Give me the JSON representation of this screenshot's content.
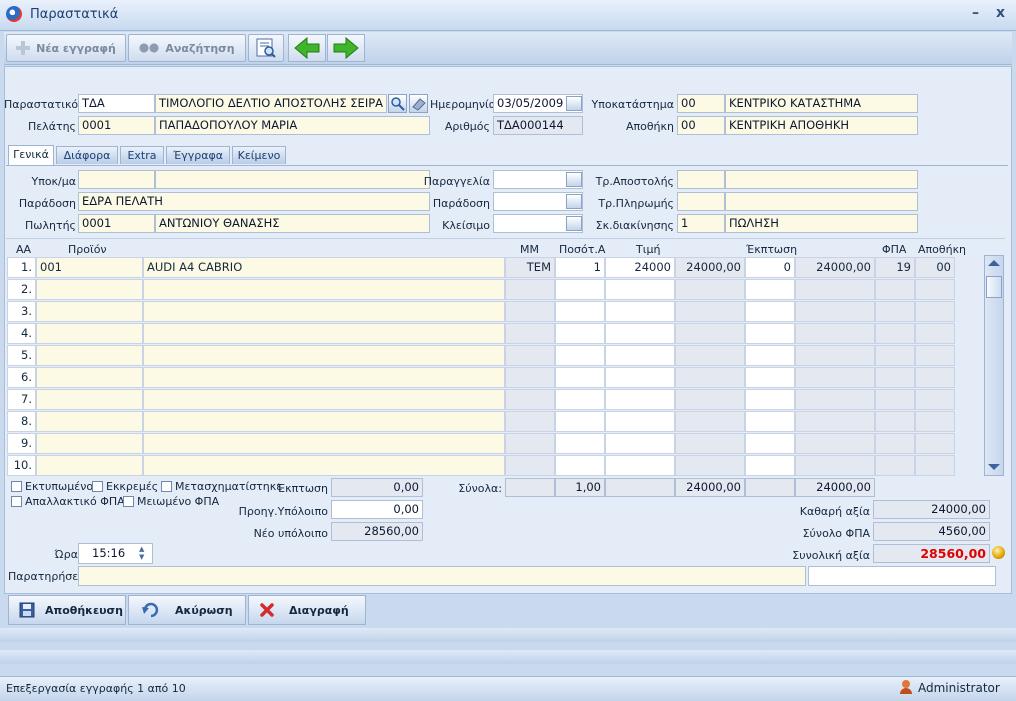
{
  "window": {
    "title": "Παραστατικά"
  },
  "toolbar": {
    "new_label": "Νέα εγγραφή",
    "search_label": "Αναζήτηση"
  },
  "header": {
    "doc_type_label": "Παραστατικό",
    "doc_type_code": "ΤΔΑ",
    "doc_type_name": "ΤΙΜΟΛΟΓΙΟ ΔΕΛΤΙΟ ΑΠΟΣΤΟΛΗΣ ΣΕΙΡΑ",
    "customer_label": "Πελάτης",
    "customer_code": "0001",
    "customer_name": "ΠΑΠΑΔΟΠΟΥΛΟΥ ΜΑΡΙΑ",
    "date_label": "Ημερομηνία",
    "date_value": "03/05/2009",
    "number_label": "Αριθμός",
    "number_value": "ΤΔΑ000144",
    "branch_label": "Υποκατάστημα",
    "branch_code": "00",
    "branch_name": "ΚΕΝΤΡΙΚΟ ΚΑΤΑΣΤΗΜΑ",
    "warehouse_label": "Αποθήκη",
    "warehouse_code": "00",
    "warehouse_name": "ΚΕΝΤΡΙΚΗ ΑΠΟΘΗΚΗ"
  },
  "tabs": [
    "Γενικά",
    "Διάφορα",
    "Extra",
    "Έγγραφα",
    "Κείμενο"
  ],
  "general": {
    "subbranch_label": "Υποκ/μα",
    "subbranch_code": "",
    "subbranch_name": "",
    "delivery_label": "Παράδοση",
    "delivery_value": "ΕΔΡΑ ΠΕΛΑΤΗ",
    "seller_label": "Πωλητής",
    "seller_code": "0001",
    "seller_name": "ΑΝΤΩΝΙΟΥ ΘΑΝΑΣΗΣ",
    "order_label": "Παραγγελία",
    "delivery2_label": "Παράδοση",
    "closing_label": "Κλείσιμο",
    "shipping_label": "Τρ.Αποστολής",
    "payment_label": "Τρ.Πληρωμής",
    "purpose_label": "Σκ.διακίνησης",
    "purpose_code": "1",
    "purpose_name": "ΠΩΛΗΣΗ"
  },
  "grid": {
    "headers": [
      "ΑΑ",
      "Προϊόν",
      "ΜΜ",
      "Ποσότ.Α",
      "Τιμή",
      "Έκπτωση",
      "ΦΠΑ",
      "Αποθήκη"
    ],
    "rows": [
      {
        "n": "1.",
        "code": "001",
        "desc": "AUDI A4 CABRIO",
        "unit": "ΤΕΜ",
        "qty": "1",
        "price": "24000",
        "amount": "24000,00",
        "disc": "0",
        "net": "24000,00",
        "vat": "19",
        "wh": "00"
      },
      {
        "n": "2."
      },
      {
        "n": "3."
      },
      {
        "n": "4."
      },
      {
        "n": "5."
      },
      {
        "n": "6."
      },
      {
        "n": "7."
      },
      {
        "n": "8."
      },
      {
        "n": "9."
      },
      {
        "n": "10."
      }
    ]
  },
  "footer": {
    "chk_printed": "Εκτυπωμένο",
    "chk_pending": "Εκκρεμές",
    "chk_converted": "Μετασχηματίστηκε",
    "chk_vat_exempt": "Απαλλακτικό ΦΠΑ",
    "chk_vat_reduced": "Μειωμένο ΦΠΑ",
    "discount_label": "Έκπτωση",
    "discount_value": "0,00",
    "prev_balance_label": "Προηγ.Υπόλοιπο",
    "prev_balance_value": "0,00",
    "new_balance_label": "Νέο υπόλοιπο",
    "new_balance_value": "28560,00",
    "totals_label": "Σύνολα:",
    "totals_qty": "1,00",
    "totals_amount": "24000,00",
    "totals_net": "24000,00",
    "net_value_label": "Καθαρή αξία",
    "net_value": "24000,00",
    "vat_total_label": "Σύνολο ΦΠΑ",
    "vat_total": "4560,00",
    "grand_total_label": "Συνολική αξία",
    "grand_total": "28560,00",
    "time_label": "Ώρα",
    "time_value": "15:16",
    "notes_label": "Παρατηρήσεις"
  },
  "actions": {
    "save": "Αποθήκευση",
    "cancel": "Ακύρωση",
    "delete": "Διαγραφή"
  },
  "status": {
    "text": "Επεξεργασία εγγραφής 1 από 10",
    "user": "Administrator"
  },
  "colors": {
    "grand_total": "#e00000",
    "field_bg": "#fcf9e4"
  }
}
